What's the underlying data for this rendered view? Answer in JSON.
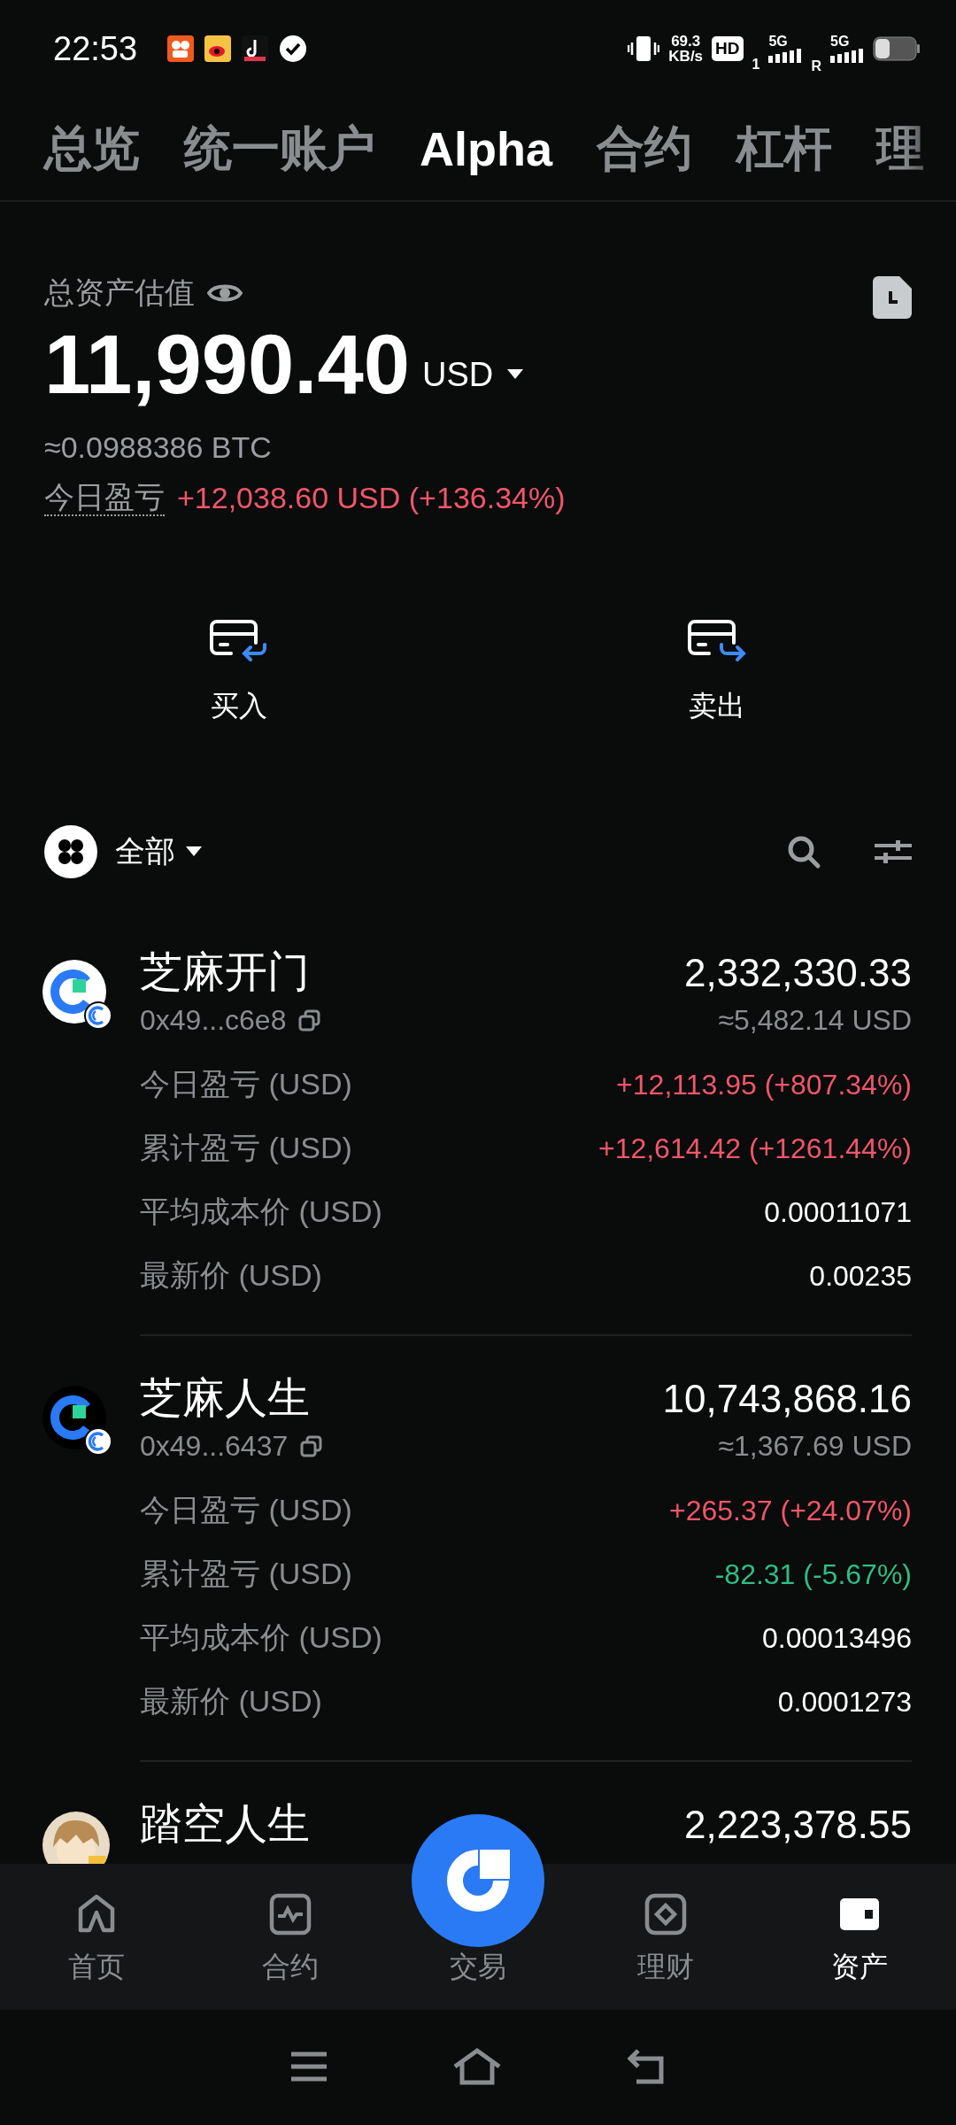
{
  "status_bar": {
    "time": "22:53",
    "speed": "69.3",
    "speed_unit": "KB/s",
    "hd": "HD",
    "hd_sim": "1",
    "net_1": "5G",
    "roaming": "R",
    "net_2": "5G"
  },
  "tabs": [
    {
      "label": "总览",
      "selected": false
    },
    {
      "label": "统一账户",
      "selected": false
    },
    {
      "label": "Alpha",
      "selected": true
    },
    {
      "label": "合约",
      "selected": false
    },
    {
      "label": "杠杆",
      "selected": false
    },
    {
      "label": "理",
      "selected": false
    }
  ],
  "summary": {
    "title": "总资产估值",
    "total": "11,990.40",
    "currency": "USD",
    "btc_value": "≈0.0988386 BTC",
    "pnl": {
      "label": "今日盈亏",
      "value": "+12,038.60 USD (+136.34%)",
      "color": "#f0566a"
    }
  },
  "actions": [
    {
      "kind": "buy",
      "label": "买入"
    },
    {
      "kind": "sell",
      "label": "卖出"
    }
  ],
  "filter": {
    "label": "全部"
  },
  "assets": [
    {
      "name": "芝麻开门",
      "address": "0x49...c6e8",
      "amount": "2,332,330.33",
      "usd_value": "≈5,482.14 USD",
      "kind": "light",
      "metrics": [
        {
          "label": "今日盈亏 (USD)",
          "value": "+12,113.95 (+807.34%)",
          "color": "#f0566a"
        },
        {
          "label": "累计盈亏 (USD)",
          "value": "+12,614.42 (+1261.44%)",
          "color": "#f0566a"
        },
        {
          "label": "平均成本价 (USD)",
          "value": "0.00011071",
          "color": "#ffffff"
        },
        {
          "label": "最新价 (USD)",
          "value": "0.00235",
          "color": "#ffffff"
        }
      ]
    },
    {
      "name": "芝麻人生",
      "address": "0x49...6437",
      "amount": "10,743,868.16",
      "usd_value": "≈1,367.69 USD",
      "kind": "dark",
      "metrics": [
        {
          "label": "今日盈亏 (USD)",
          "value": "+265.37 (+24.07%)",
          "color": "#f0566a"
        },
        {
          "label": "累计盈亏 (USD)",
          "value": "-82.31 (-5.67%)",
          "color": "#2ebd85"
        },
        {
          "label": "平均成本价 (USD)",
          "value": "0.00013496",
          "color": "#ffffff"
        },
        {
          "label": "最新价 (USD)",
          "value": "0.0001273",
          "color": "#ffffff"
        }
      ]
    },
    {
      "name": "踏空人生",
      "amount": "2,223,378.55",
      "kind": "picture"
    }
  ],
  "bottom_nav": [
    {
      "kind": "home",
      "label": "首页",
      "selected": false
    },
    {
      "kind": "futures",
      "label": "合约",
      "selected": false
    },
    {
      "kind": "trade",
      "label": "交易",
      "selected": false
    },
    {
      "kind": "earn",
      "label": "理财",
      "selected": false
    },
    {
      "kind": "assets",
      "label": "资产",
      "selected": true
    }
  ]
}
